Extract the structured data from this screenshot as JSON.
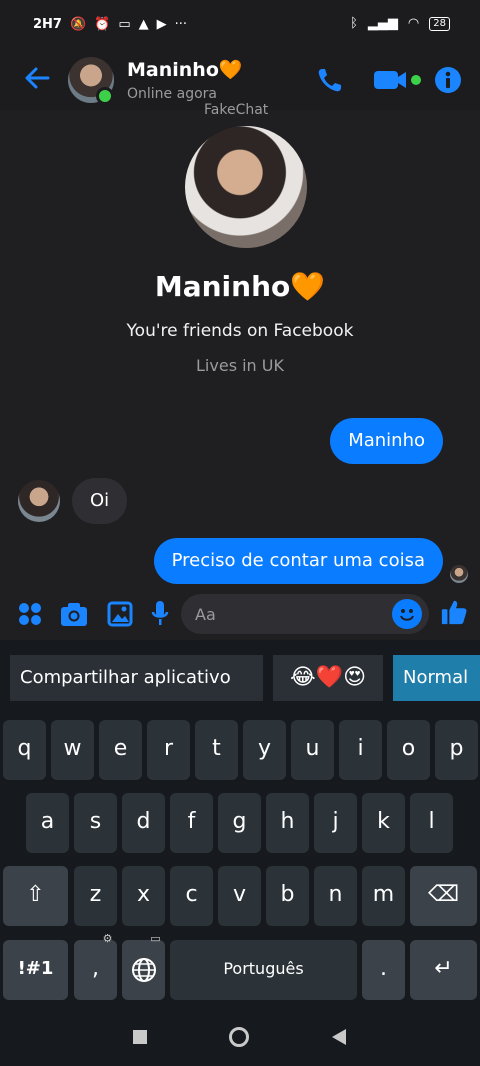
{
  "status_bar": {
    "time": "2H7",
    "battery": "28",
    "more": "···"
  },
  "header": {
    "name": "Maninho🧡",
    "status": "Online agora",
    "watermark": "FakeChat",
    "accent": "#0a7cff",
    "online_color": "#3dd14a"
  },
  "profile": {
    "name": "Maninho🧡",
    "friends_text": "You're friends on Facebook",
    "lives_text": "Lives in UK"
  },
  "messages": [
    {
      "from": "me",
      "text": "Maninho"
    },
    {
      "from": "them",
      "text": "Oi"
    },
    {
      "from": "me",
      "text": "Preciso de contar uma coisa"
    }
  ],
  "composer": {
    "placeholder": "Aa"
  },
  "keyboard": {
    "suggestions": [
      "Compartilhar aplicativo",
      "😂❤️😍",
      "Normal"
    ],
    "row1": [
      "q",
      "w",
      "e",
      "r",
      "t",
      "y",
      "u",
      "i",
      "o",
      "p"
    ],
    "row2": [
      "a",
      "s",
      "d",
      "f",
      "g",
      "h",
      "j",
      "k",
      "l"
    ],
    "row3": [
      "z",
      "x",
      "c",
      "v",
      "b",
      "n",
      "m"
    ],
    "shift": "⇧",
    "backspace": "⌫",
    "symbols": "!#1",
    "comma": ",",
    "period": ".",
    "space": "Português",
    "enter": "↵"
  },
  "icons": {
    "back": "arrow-left-icon",
    "call": "phone-icon",
    "video": "video-camera-icon",
    "info": "info-icon",
    "apps": "apps-grid-icon",
    "camera": "camera-icon",
    "gallery": "image-icon",
    "mic": "microphone-icon",
    "emoji": "emoji-icon",
    "like": "thumbs-up-icon"
  }
}
